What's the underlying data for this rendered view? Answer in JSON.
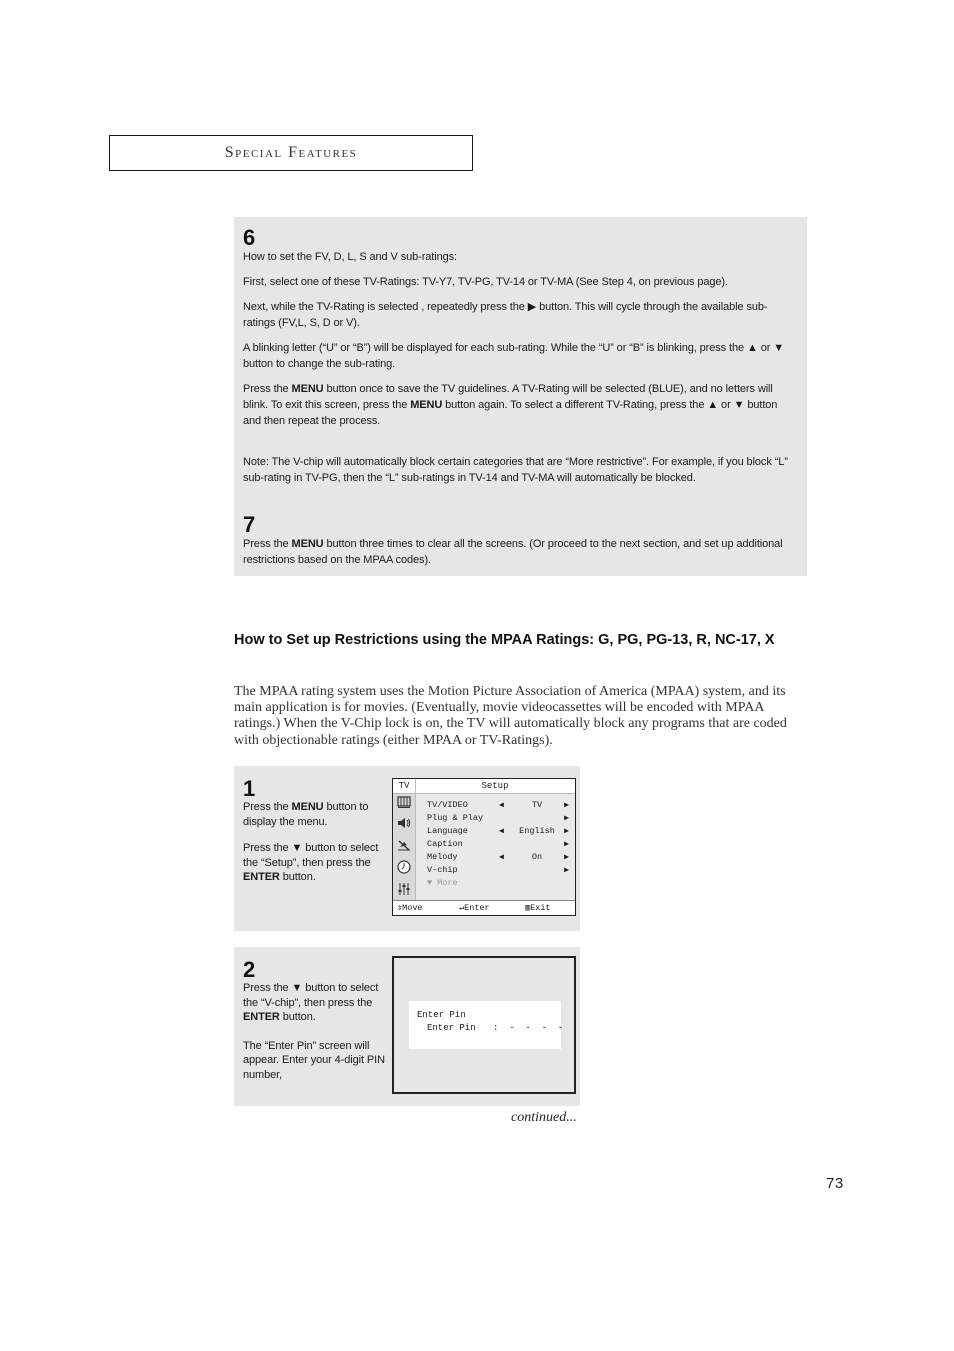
{
  "header": {
    "title": "Special Features"
  },
  "steps_top": [
    {
      "number": "6",
      "paragraphs": [
        "How to set the FV, D, L, S and V sub-ratings:",
        "First, select one of these TV-Ratings: TV-Y7, TV-PG, TV-14 or TV-MA (See Step 4, on previous page).",
        [
          "Next, while the TV-Rating is selected , repeatedly press the ",
          "▶",
          " button.  This will cycle through the available sub-ratings (FV,L, S, D or V)."
        ],
        [
          "A blinking letter (“U” or “B”) will be displayed for each sub-rating. While the “U” or “B” is blinking, press the ",
          "▲",
          " or ",
          "▼",
          " button to change the sub-rating."
        ],
        [
          "Press the ",
          "MENU",
          " button once to save the TV guidelines. A TV-Rating will be selected (BLUE), and no letters will blink. To exit this screen, press the ",
          "MENU",
          " button again. To select a different TV-Rating, press the ",
          "▲",
          " or ",
          "▼",
          " button and then repeat the process."
        ],
        "Note: The V-chip will automatically block certain categories that are “More restrictive”. For example, if you block “L” sub-rating in TV-PG, then the “L” sub-ratings in TV-14 and TV-MA will automatically be blocked."
      ]
    },
    {
      "number": "7",
      "paragraphs": [
        [
          "Press the ",
          "MENU",
          " button three times to clear all the screens. (Or proceed to the next section, and set up additional restrictions based on the MPAA codes)."
        ]
      ]
    }
  ],
  "section": {
    "heading": "How to Set up Restrictions using the MPAA Ratings: G, PG, PG-13, R, NC-17, X",
    "body": "The MPAA rating system uses the Motion Picture Association of America (MPAA) system, and its main application is for movies. (Eventually, movie videocassettes will be encoded with MPAA ratings.) When the V-Chip lock is on, the TV will automatically block any programs that are coded with objectionable ratings (either MPAA or TV-Ratings)."
  },
  "step1": {
    "number": "1",
    "line1_a": "Press the ",
    "line1_b": "MENU",
    "line1_c": " button to display the menu.",
    "line2_a": "Press the ",
    "line2_arrow": "▼",
    "line2_b": " button to select the “Setup”, then press the ",
    "line2_c": "ENTER",
    "line2_d": " button.",
    "osd": {
      "source": "TV",
      "title": "Setup",
      "rows": [
        {
          "label": "TV/VIDEO",
          "left_arrow": "◀",
          "value": "TV",
          "right_arrow": "▶"
        },
        {
          "label": "Plug & Play",
          "left_arrow": "",
          "value": "",
          "right_arrow": "▶"
        },
        {
          "label": "Language",
          "left_arrow": "◀",
          "value": "English",
          "right_arrow": "▶"
        },
        {
          "label": "Caption",
          "left_arrow": "",
          "value": "",
          "right_arrow": "▶"
        },
        {
          "label": "Melody",
          "left_arrow": "◀",
          "value": "On",
          "right_arrow": "▶"
        },
        {
          "label": "V-chip",
          "left_arrow": "",
          "value": "",
          "right_arrow": "▶"
        },
        {
          "label": "▼ More",
          "left_arrow": "",
          "value": "",
          "right_arrow": ""
        }
      ],
      "sidebar_icons": [
        "picture-icon",
        "sound-icon",
        "channel-icon",
        "clock-icon",
        "setup-icon"
      ],
      "footer": {
        "move": "Move",
        "enter": "Enter",
        "exit": "Exit"
      }
    }
  },
  "step2": {
    "number": "2",
    "line1_a": "Press the ",
    "line1_arrow": "▼",
    "line1_b": " button to select  the “V-chip”, then press the ",
    "line1_c": "ENTER",
    "line1_d": " button.",
    "line2": "The “Enter Pin” screen will appear. Enter your 4-digit PIN number,",
    "pin_screen": {
      "title": "Enter Pin",
      "field_label": "Enter Pin",
      "field_value": ":  -  -  -  -"
    }
  },
  "footer": {
    "continued": "continued...",
    "page_number": "73"
  }
}
